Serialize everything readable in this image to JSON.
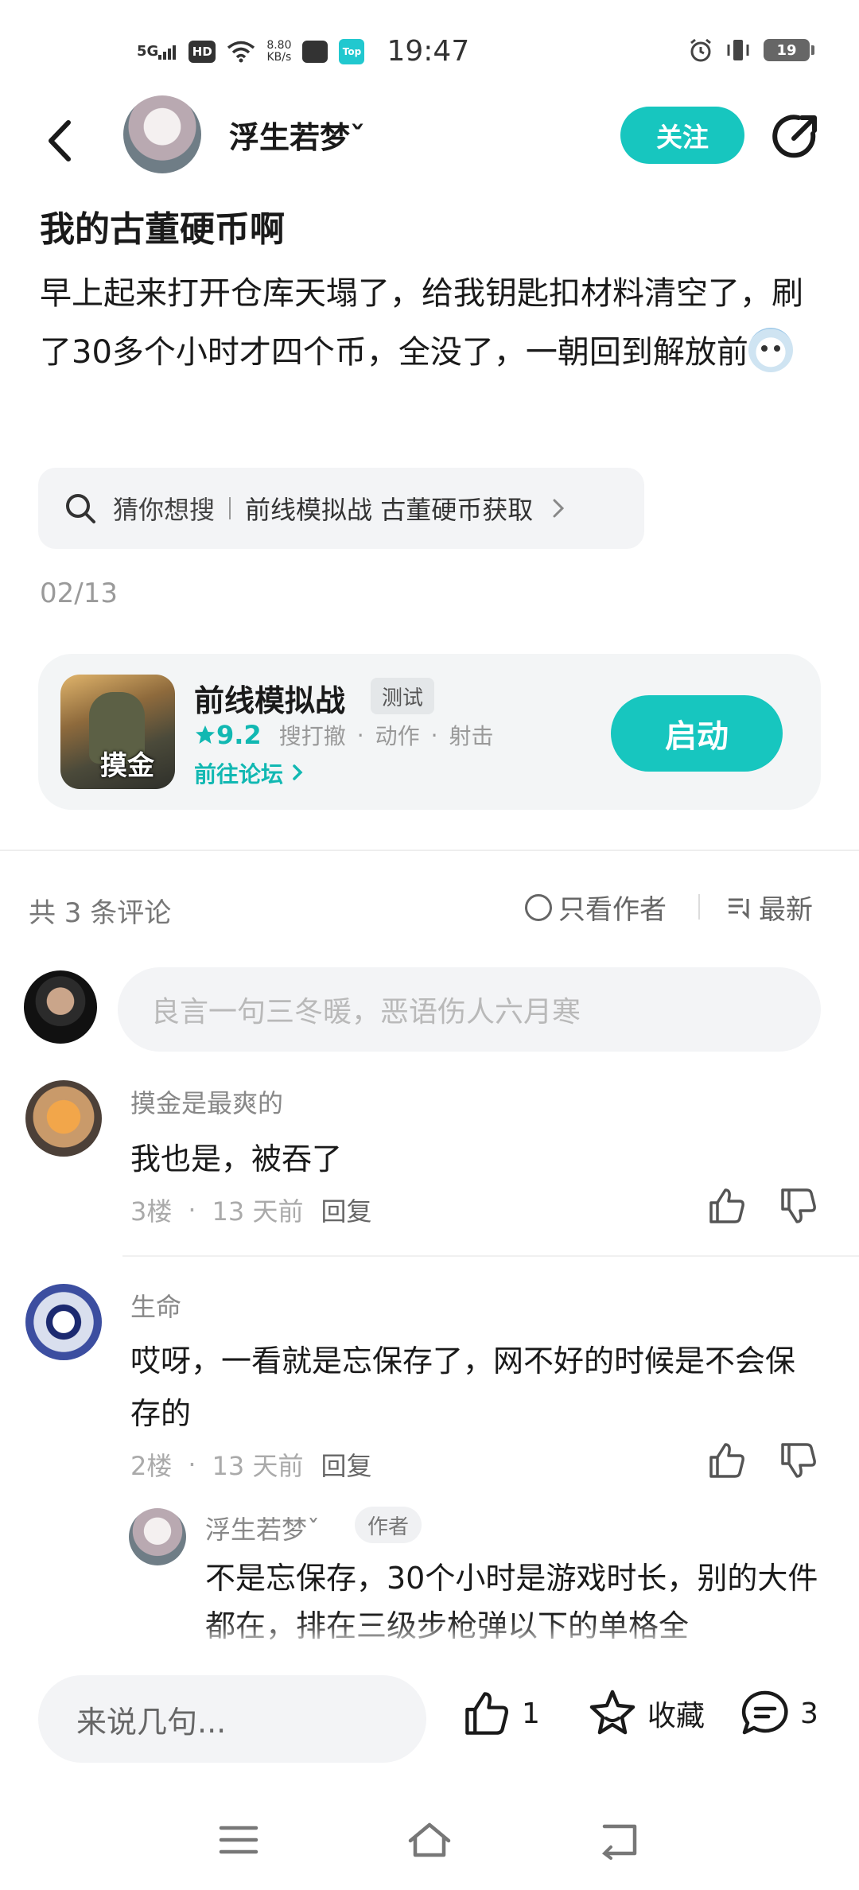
{
  "status_bar": {
    "signal": "5G",
    "hd": "HD",
    "net_speed_value": "8.80",
    "net_speed_unit": "KB/s",
    "top_app_label": "Top",
    "time": "19:47",
    "battery": "19"
  },
  "header": {
    "author_name": "浮生若梦ˇ",
    "follow_label": "关注"
  },
  "post": {
    "title": "我的古董硬币啊",
    "body": "早上起来打开仓库天塌了，给我钥匙扣材料清空了，刷了30多个小时才四个币，全没了，一朝回到解放前",
    "date": "02/13"
  },
  "search_suggest": {
    "label": "猜你想搜",
    "keyword": "前线模拟战 古董硬币获取"
  },
  "game_card": {
    "icon_badge": "摸金",
    "name": "前线模拟战",
    "tag": "测试",
    "rating": "9.2",
    "genres": [
      "搜打撤",
      "动作",
      "射击"
    ],
    "forum_link": "前往论坛",
    "launch_label": "启动"
  },
  "comments_header": {
    "count_text": "共 3 条评论",
    "only_author": "只看作者",
    "sort": "最新"
  },
  "comment_input": {
    "placeholder": "良言一句三冬暖，恶语伤人六月寒"
  },
  "comments": [
    {
      "user": "摸金是最爽的",
      "text": "我也是，被吞了",
      "floor": "3楼",
      "time": "13 天前",
      "reply": "回复"
    },
    {
      "user": "生命",
      "text": "哎呀，一看就是忘保存了，网不好的时候是不会保存的",
      "floor": "2楼",
      "time": "13 天前",
      "reply": "回复",
      "replies": [
        {
          "user": "浮生若梦ˇ",
          "tag": "作者",
          "text": "不是忘保存，30个小时是游戏时长，别的大件都在，排在三级步枪弹以下的单格全"
        }
      ]
    }
  ],
  "bottom_bar": {
    "input_placeholder": "来说几句...",
    "like_count": "1",
    "collect_label": "收藏",
    "comment_count": "3"
  },
  "colors": {
    "accent": "#17c6bf",
    "accent_text": "#11b8b2"
  }
}
